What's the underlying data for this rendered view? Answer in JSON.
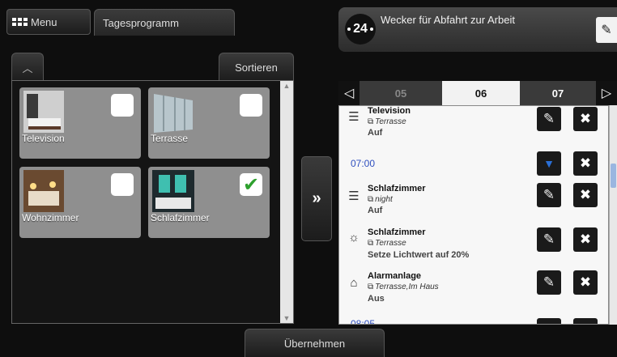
{
  "header": {
    "menu_label": "Menu",
    "tab_label": "Tagesprogramm"
  },
  "alarm": {
    "clock_value": "24",
    "title": "Wecker für Abfahrt zur Arbeit"
  },
  "left_panel": {
    "sort_label": "Sortieren",
    "devices": [
      {
        "label": "Television",
        "checked": false
      },
      {
        "label": "Terrasse",
        "checked": false
      },
      {
        "label": "Wohnzimmer",
        "checked": false
      },
      {
        "label": "Schlafzimmer",
        "checked": true
      }
    ]
  },
  "transfer_glyph": "»",
  "apply_label": "Übernehmen",
  "days": {
    "prev": "05",
    "current": "06",
    "next": "07"
  },
  "schedule": {
    "entries": [
      {
        "icon": "blinds-icon",
        "title": "Television",
        "room": "Terrasse",
        "value": "Auf"
      },
      {
        "time": "07:00"
      },
      {
        "icon": "blinds-icon",
        "title": "Schlafzimmer",
        "room": "night",
        "value": "Auf"
      },
      {
        "icon": "light-icon",
        "title": "Schlafzimmer",
        "room": "Terrasse",
        "value": "Setze Lichtwert auf 20%"
      },
      {
        "icon": "alarm-system-icon",
        "title": "Alarmanlage",
        "room": "Terrasse,Im Haus",
        "value": "Aus"
      },
      {
        "time": "08:05"
      }
    ]
  },
  "colors": {
    "checkmark": "#2ea02e",
    "time": "#2f4fbf",
    "arrow_down": "#2a6fd6"
  }
}
